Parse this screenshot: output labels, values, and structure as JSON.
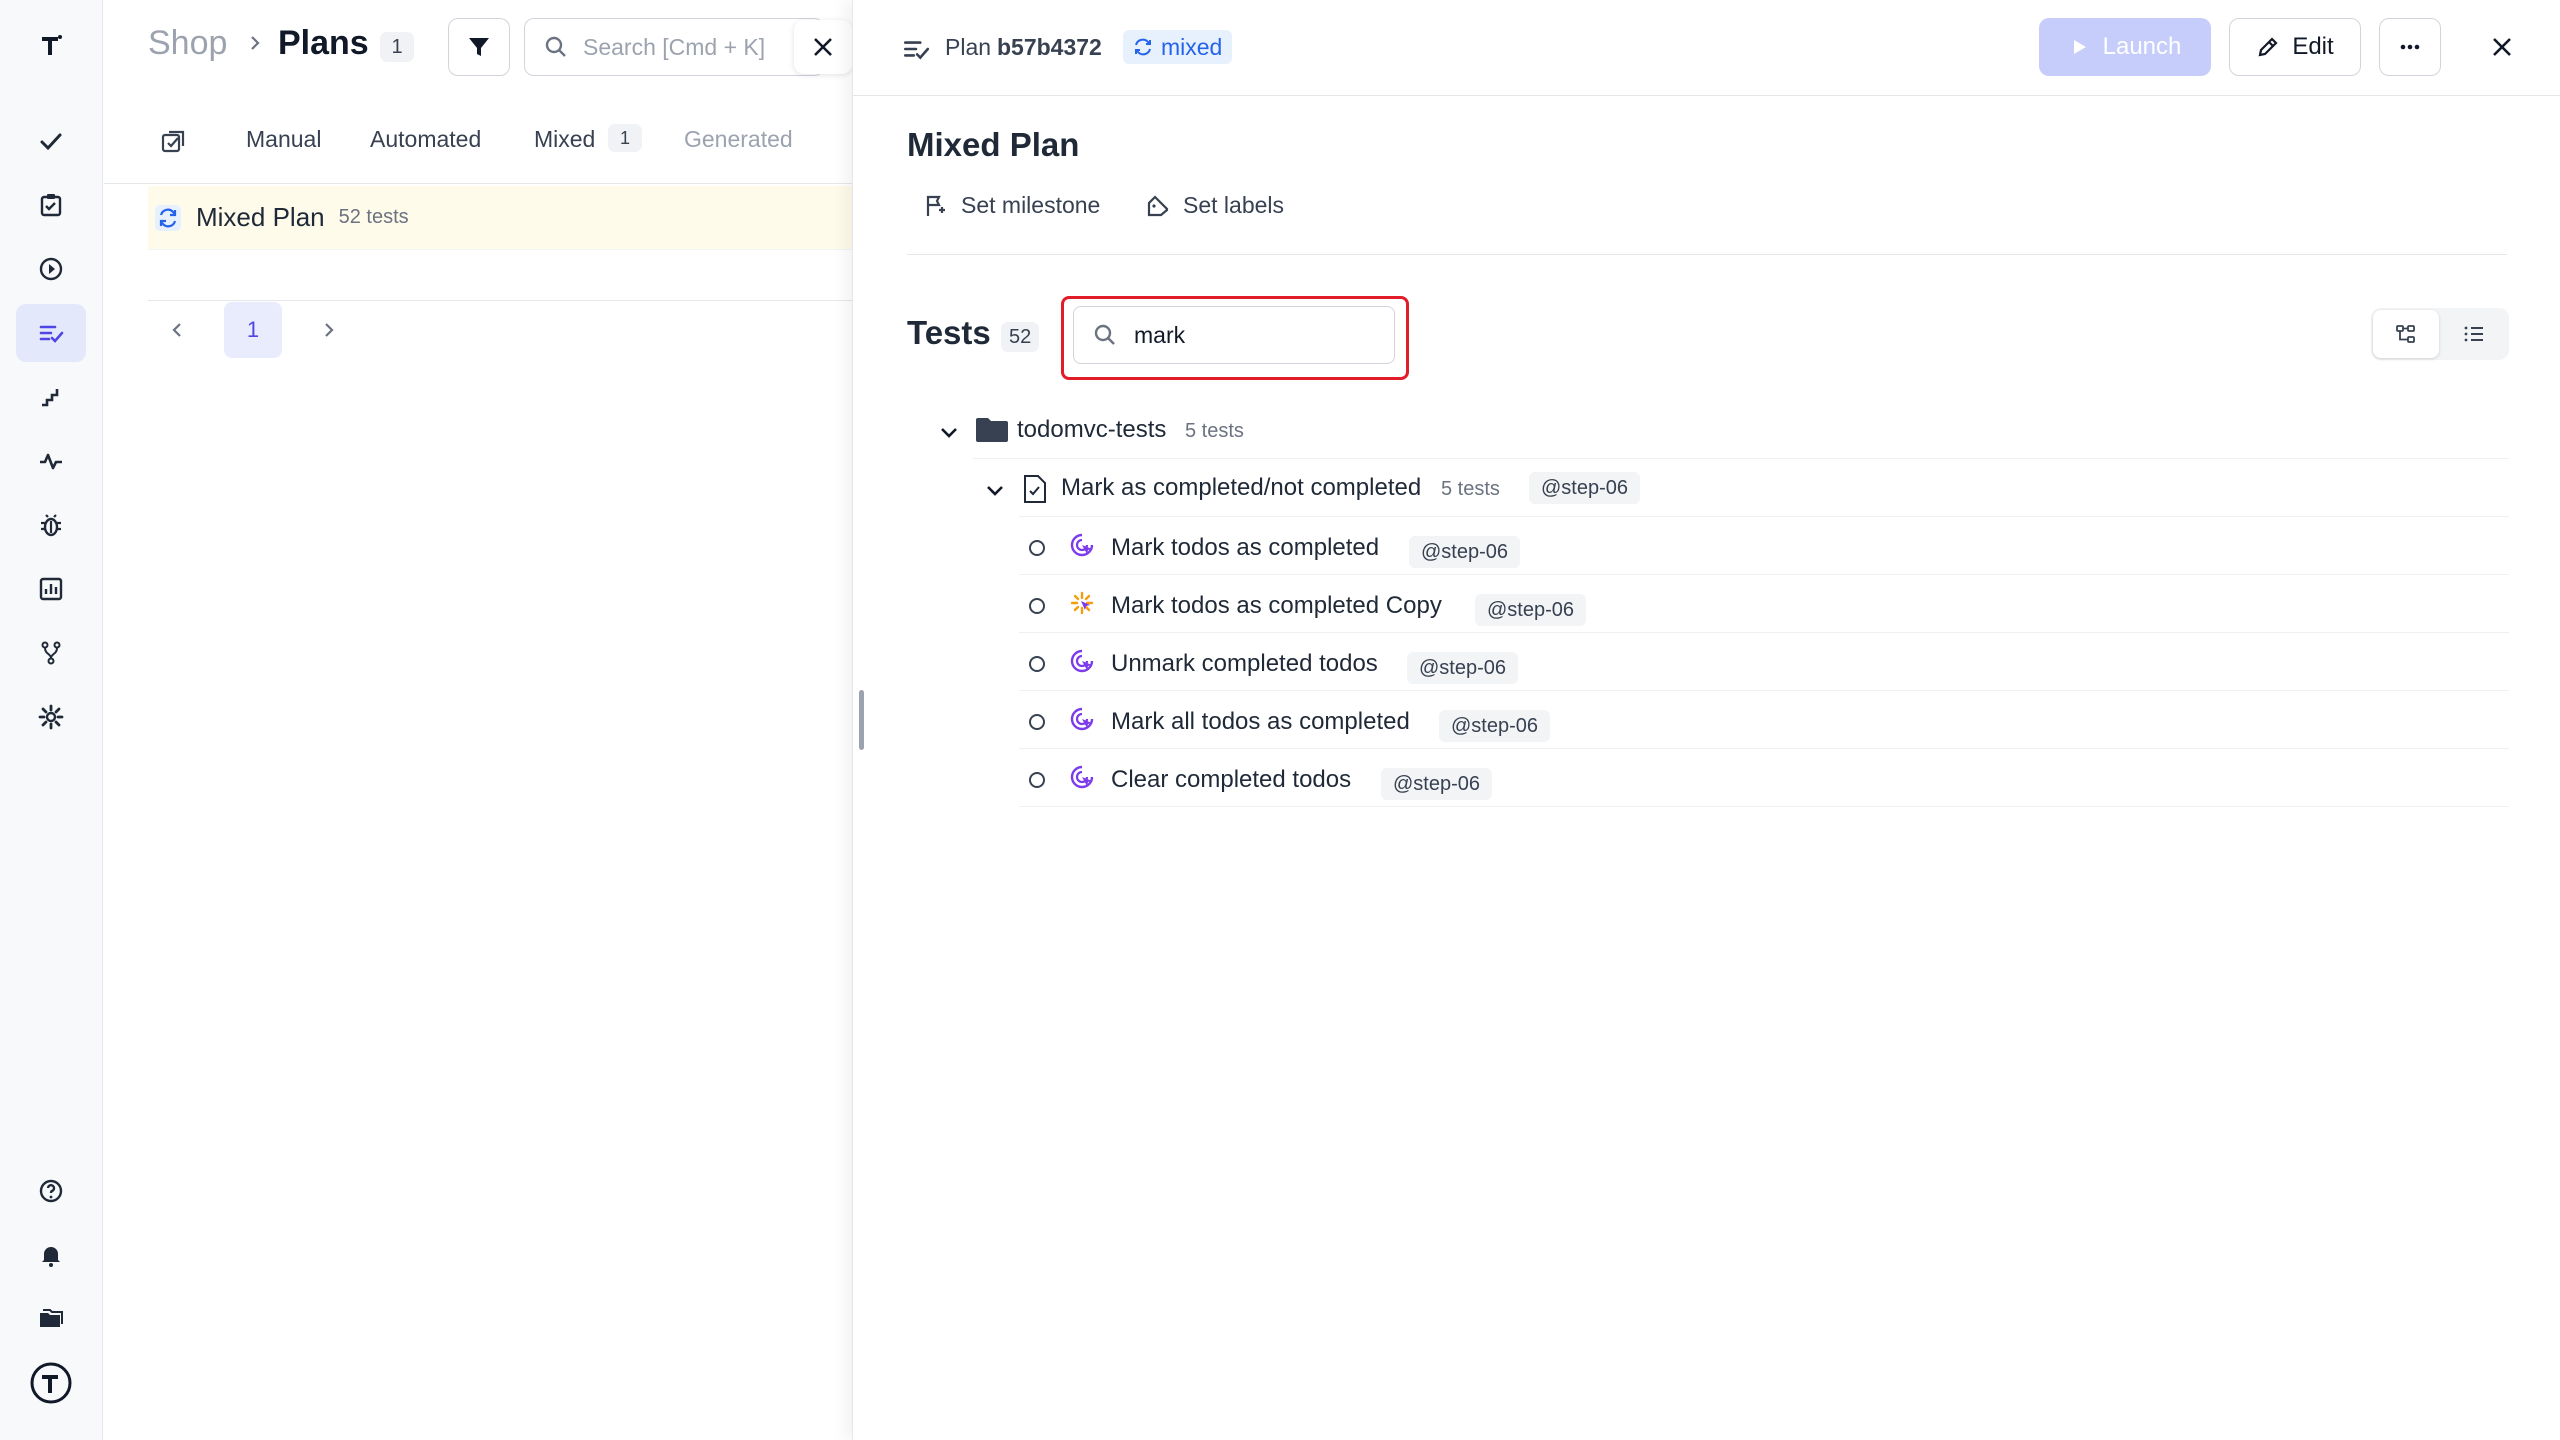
{
  "app": {
    "rail": {
      "top_items": [
        "check-icon",
        "clipboard-icon",
        "play-circle-icon",
        "plans-icon",
        "steps-icon",
        "pulse-icon",
        "bug-icon",
        "chart-icon",
        "branch-icon",
        "gear-icon"
      ],
      "bottom_items": [
        "help-icon",
        "bell-icon",
        "folders-icon",
        "logo-icon"
      ],
      "active": "plans-icon"
    }
  },
  "list": {
    "breadcrumb": {
      "project": "Shop",
      "section": "Plans",
      "count": "1"
    },
    "search": {
      "placeholder": "Search [Cmd + K]",
      "value": ""
    },
    "tabs": [
      {
        "label": "Manual"
      },
      {
        "label": "Automated"
      },
      {
        "label": "Mixed",
        "count": "1"
      },
      {
        "label": "Generated"
      }
    ],
    "plans": [
      {
        "name": "Mixed Plan",
        "meta": "52 tests"
      }
    ],
    "pagination": {
      "current": "1"
    }
  },
  "detail": {
    "header": {
      "label": "Plan",
      "id": "b57b4372",
      "type": "mixed",
      "launch": "Launch",
      "edit": "Edit"
    },
    "title": "Mixed Plan",
    "actions": {
      "milestone": "Set milestone",
      "labels": "Set labels"
    },
    "tests": {
      "title": "Tests",
      "count": "52",
      "search_value": "mark",
      "folder": {
        "name": "todomvc-tests",
        "meta": "5 tests"
      },
      "suite": {
        "name": "Mark as completed/not completed",
        "meta": "5 tests",
        "tag": "@step-06"
      },
      "items": [
        {
          "name": "Mark todos as completed",
          "tag": "@step-06",
          "icon": "automated"
        },
        {
          "name": "Mark todos as completed Copy",
          "tag": "@step-06",
          "icon": "manual"
        },
        {
          "name": "Unmark completed todos",
          "tag": "@step-06",
          "icon": "automated"
        },
        {
          "name": "Mark all todos as completed",
          "tag": "@step-06",
          "icon": "automated"
        },
        {
          "name": "Clear completed todos",
          "tag": "@step-06",
          "icon": "automated"
        }
      ]
    }
  },
  "colors": {
    "accent": "#4f46e5",
    "launch_disabled": "#c7cdfb",
    "highlight": "#e11d2a",
    "mixed_tag_bg": "#e6f1fd",
    "automated_icon": "#7c3aed",
    "manual_icon": "#f59e0b"
  }
}
